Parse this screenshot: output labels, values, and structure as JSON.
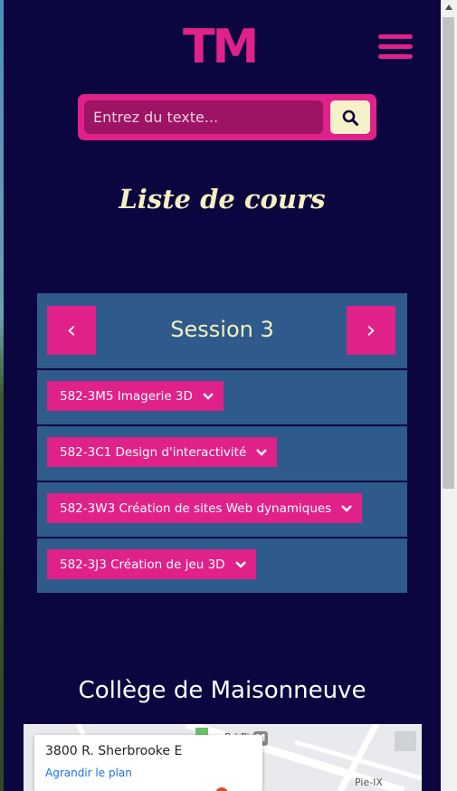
{
  "header": {
    "logo_text": "TM"
  },
  "search": {
    "placeholder": "Entrez du texte..."
  },
  "list_title": "Liste de cours",
  "session": {
    "title": "Session 3",
    "prev_label": "‹",
    "next_label": "›",
    "courses": [
      {
        "label": "582-3M5 Imagerie 3D"
      },
      {
        "label": "582-3C1 Design d'interactivité"
      },
      {
        "label": "582-3W3 Création de sites Web dynamiques"
      },
      {
        "label": "582-3J3 Création de jeu 3D"
      }
    ]
  },
  "college": {
    "title": "Collège de Maisonneuve",
    "address": "3800 R. Sherbrooke E",
    "map_link": "Agrandir le plan",
    "metro_label": "M",
    "road_label_1": "Bd Pi",
    "road_label_2": "Pie-IX"
  },
  "colors": {
    "background": "#0b0640",
    "accent": "#e0218a",
    "panel": "#2f5a8c",
    "cream": "#f7f0c0"
  }
}
